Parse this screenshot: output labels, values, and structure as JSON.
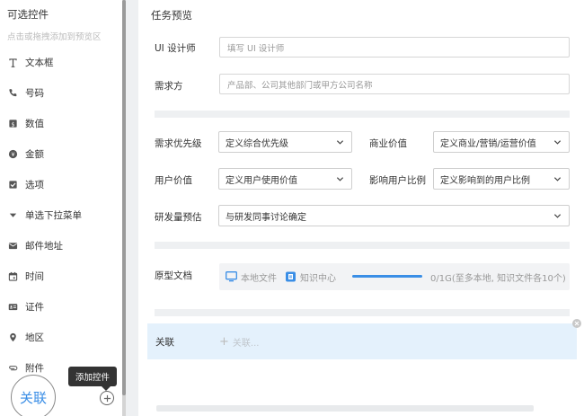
{
  "left_panel": {
    "title": "可选控件",
    "hint": "点击或拖拽添加到预览区",
    "controls": [
      {
        "label": "文本框",
        "icon": "text-icon"
      },
      {
        "label": "号码",
        "icon": "phone-icon"
      },
      {
        "label": "数值",
        "icon": "number-icon"
      },
      {
        "label": "金额",
        "icon": "money-icon"
      },
      {
        "label": "选项",
        "icon": "checkbox-icon"
      },
      {
        "label": "单选下拉菜单",
        "icon": "dropdown-icon"
      },
      {
        "label": "邮件地址",
        "icon": "mail-icon"
      },
      {
        "label": "时间",
        "icon": "calendar-icon"
      },
      {
        "label": "证件",
        "icon": "id-card-icon"
      },
      {
        "label": "地区",
        "icon": "location-icon"
      },
      {
        "label": "附件",
        "icon": "attachment-icon"
      }
    ],
    "tooltip": "添加控件",
    "drag_ghost_label": "关联"
  },
  "preview": {
    "title": "任务预览",
    "designer": {
      "label": "UI 设计师",
      "placeholder": "填写 UI 设计师"
    },
    "requester": {
      "label": "需求方",
      "placeholder": "产品部、公司其他部门或甲方公司名称"
    },
    "priority": {
      "label": "需求优先级",
      "value": "定义综合优先级"
    },
    "business_value": {
      "label": "商业价值",
      "value": "定义商业/营销/运营价值"
    },
    "user_value": {
      "label": "用户价值",
      "value": "定义用户使用价值"
    },
    "user_ratio": {
      "label": "影响用户比例",
      "value": "定义影响到的用户比例"
    },
    "effort": {
      "label": "研发量预估",
      "value": "与研发同事讨论确定"
    },
    "prototype": {
      "label": "原型文档",
      "local": "本地文件",
      "knowledge": "知识中心",
      "info": "0/1G(至多本地, 知识文件各10个)"
    },
    "relation": {
      "label": "关联",
      "add_label": "关联..."
    }
  },
  "colors": {
    "accent": "#3a8ee6",
    "relation_bg": "#e4f1fc",
    "divider": "#eef0f2"
  }
}
